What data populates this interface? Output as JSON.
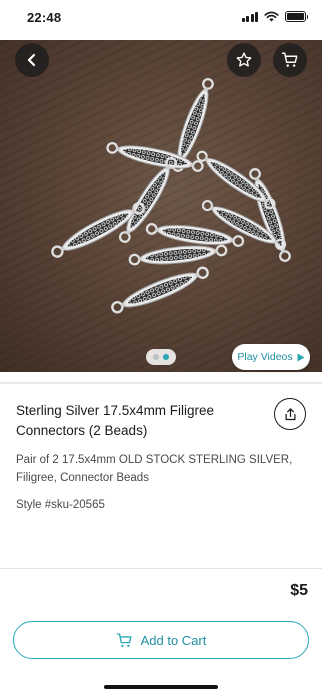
{
  "status_bar": {
    "time": "22:48"
  },
  "product": {
    "title": "Sterling Silver 17.5x4mm Filigree Connectors (2 Beads)",
    "description": "Pair of 2 17.5x4mm OLD STOCK STERLING SILVER, Filigree, Connector Beads",
    "style": "Style #sku-20565",
    "price": "$5"
  },
  "gallery": {
    "play_videos_label": "Play Videos",
    "image_count": 2,
    "active_image": 2
  },
  "actions": {
    "add_to_cart_label": "Add to Cart"
  },
  "icons": {
    "back": "chevron-left-icon",
    "favorite": "star-icon",
    "cart": "cart-icon",
    "share": "share-icon",
    "play": "play-icon"
  },
  "colors": {
    "accent": "#2aa7b5",
    "accent_text": "#1f8fa0",
    "overlay_button": "#1e1e1e"
  }
}
